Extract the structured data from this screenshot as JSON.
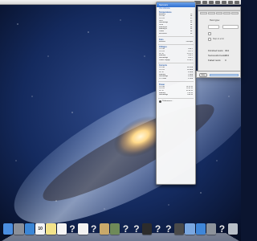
{
  "desktop": {
    "wallpaper": "galaxy"
  },
  "sensor_menu": {
    "title": "Sensors",
    "links": [
      "Visit Website"
    ],
    "groups": [
      {
        "title": "Temperatures",
        "rows": [
          [
            "Ambient",
            "22°"
          ],
          [
            "CPU A",
            "58°"
          ],
          [
            "CPU B",
            "57°"
          ],
          [
            "GPU",
            "51°"
          ],
          [
            "Northbridge",
            "49°"
          ],
          [
            "Drive",
            "38°"
          ],
          [
            "Memory A",
            "44°"
          ],
          [
            "Memory B",
            "45°"
          ],
          [
            "Power",
            "40°"
          ],
          [
            "Enclosure",
            "33°"
          ]
        ]
      },
      {
        "title": "Fans",
        "rows": [
          [
            "Exhaust",
            "1500rpm"
          ]
        ]
      },
      {
        "title": "Voltages",
        "rows": [
          [
            "CPU A",
            "0.88 V"
          ],
          [
            "CPU B",
            "0.87 V"
          ],
          [
            "DC In",
            "12.01 V"
          ],
          [
            "Memory",
            "1.50 V"
          ],
          [
            "Northbridge",
            "1.05 V"
          ],
          [
            "Power Supply",
            "11.98 V"
          ]
        ]
      },
      {
        "title": "Currents",
        "rows": [
          [
            "CPU A",
            "16.52 A"
          ],
          [
            "CPU B",
            "15.88 A"
          ],
          [
            "DC In",
            "4.40 A"
          ],
          [
            "Memory",
            "1.30 A"
          ],
          [
            "Northbridge",
            "0.65 A"
          ],
          [
            "PCI Slots",
            "0.20 A"
          ]
        ]
      },
      {
        "title": "Power",
        "rows": [
          [
            "CPU A",
            "14.53 W"
          ],
          [
            "CPU B",
            "13.82 W"
          ],
          [
            "DC In",
            "52.84 W"
          ],
          [
            "Memory",
            "1.95 W"
          ],
          [
            "Northbridge",
            "0.68 W"
          ]
        ]
      }
    ],
    "footer": "Preferences..."
  },
  "test_window": {
    "type_label": "Test type:",
    "checkbox_label": "Stop on error",
    "stats": [
      {
        "label": "Finished tests:",
        "value": "304"
      },
      {
        "label": "Successful tests:",
        "value": "304"
      },
      {
        "label": "Failed tests:",
        "value": "0"
      }
    ]
  },
  "dialog": {
    "stop_label": "Stop"
  },
  "dock": {
    "icons": [
      {
        "name": "finder-icon",
        "color": "#4a8ee0",
        "text": ""
      },
      {
        "name": "launchpad-icon",
        "color": "#8a8f99",
        "text": ""
      },
      {
        "name": "safari-icon",
        "color": "#3b86d6",
        "text": ""
      },
      {
        "name": "calendar-icon",
        "color": "#f4f4f4",
        "text": "10"
      },
      {
        "name": "notes-icon",
        "color": "#f3e38a",
        "text": ""
      },
      {
        "name": "reminders-icon",
        "color": "#f5f5f5",
        "text": ""
      },
      {
        "name": "unknown-app-icon",
        "color": "transparent",
        "text": "?"
      },
      {
        "name": "textedit-icon",
        "color": "#f2f2f2",
        "text": ""
      },
      {
        "name": "unknown-app-icon",
        "color": "transparent",
        "text": "?"
      },
      {
        "name": "preview-icon",
        "color": "#c9a96a",
        "text": ""
      },
      {
        "name": "iphoto-icon",
        "color": "#6f8a58",
        "text": ""
      },
      {
        "name": "unknown-app-icon",
        "color": "transparent",
        "text": "?"
      },
      {
        "name": "unknown-app-icon",
        "color": "transparent",
        "text": "?"
      },
      {
        "name": "activity-monitor-icon",
        "color": "#2c2c2c",
        "text": ""
      },
      {
        "name": "unknown-app-icon",
        "color": "transparent",
        "text": "?"
      },
      {
        "name": "unknown-app-icon",
        "color": "transparent",
        "text": "?"
      },
      {
        "name": "console-icon",
        "color": "#4a4a4a",
        "text": ""
      },
      {
        "name": "itunes-icon",
        "color": "#7aa7e0",
        "text": ""
      },
      {
        "name": "app-store-icon",
        "color": "#3f86d8",
        "text": ""
      },
      {
        "name": "system-preferences-icon",
        "color": "#8d939b",
        "text": ""
      },
      {
        "name": "unknown-app-icon",
        "color": "transparent",
        "text": "?"
      },
      {
        "name": "trash-icon",
        "color": "#b8bfc8",
        "text": ""
      }
    ]
  }
}
